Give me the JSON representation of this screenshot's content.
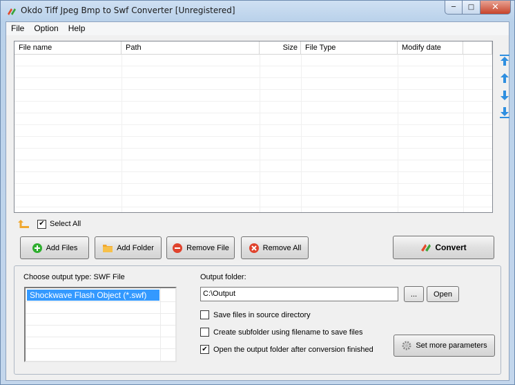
{
  "window": {
    "title": "Okdo Tiff Jpeg Bmp to Swf Converter [Unregistered]",
    "controls": {
      "minimize": "─",
      "maximize": "□",
      "close": "✕"
    }
  },
  "menu": {
    "items": [
      "File",
      "Option",
      "Help"
    ]
  },
  "file_list": {
    "columns": [
      "File name",
      "Path",
      "Size",
      "File Type",
      "Modify date"
    ],
    "rows": []
  },
  "side_arrows": [
    "move-to-top-icon",
    "move-up-icon",
    "move-down-icon",
    "move-to-bottom-icon"
  ],
  "selection": {
    "select_all_label": "Select All",
    "select_all_checked": true
  },
  "buttons": {
    "add_files": "Add Files",
    "add_folder": "Add Folder",
    "remove_file": "Remove File",
    "remove_all": "Remove All",
    "convert": "Convert"
  },
  "output": {
    "type_label": "Choose output type:",
    "type_value": "SWF File",
    "types": [
      "Shockwave Flash Object (*.swf)"
    ],
    "folder_label": "Output folder:",
    "folder_value": "C:\\Output",
    "browse_label": "...",
    "open_label": "Open",
    "options": [
      {
        "label": "Save files in source directory",
        "checked": false
      },
      {
        "label": "Create subfolder using filename to save files",
        "checked": false
      },
      {
        "label": "Open the output folder after conversion finished",
        "checked": true
      }
    ],
    "more_params_label": "Set more parameters"
  },
  "colors": {
    "accent_selection": "#3399ff",
    "arrow_blue": "#2f8fe0",
    "add_green": "#2fae2f",
    "remove_red": "#e0432d",
    "folder_orange": "#f0a830"
  }
}
